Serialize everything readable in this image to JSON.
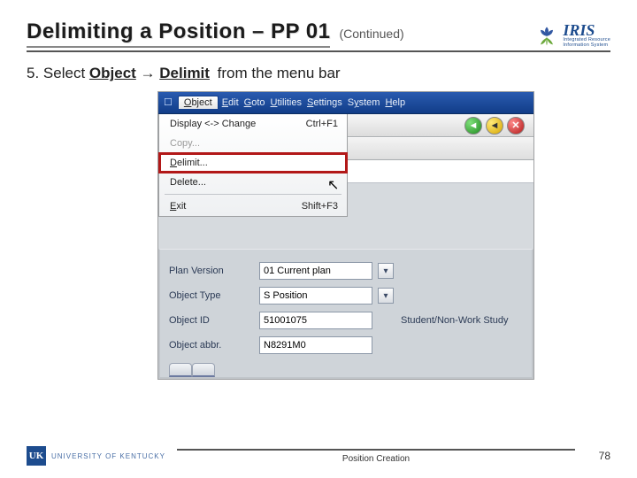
{
  "header": {
    "title": "Delimiting a Position – PP 01",
    "suffix": "(Continued)"
  },
  "iris": {
    "name": "IRIS",
    "tag1": "Integrated Resource",
    "tag2": "Information System"
  },
  "instruction": {
    "num": "5.",
    "lead": "Select ",
    "obj": "Object",
    "arrow": " → ",
    "del": "Delimit",
    "trail": " from the menu bar"
  },
  "sap": {
    "menu": {
      "object": "Object",
      "edit": "Edit",
      "goto": "Goto",
      "utilities": "Utilities",
      "settings": "Settings",
      "system": "System",
      "help": "Help"
    },
    "dropdown": {
      "display": {
        "label": "Display <-> Change",
        "shortcut": "Ctrl+F1"
      },
      "copy": "Copy...",
      "delimit": "Delimit...",
      "delete": "Delete...",
      "exit": {
        "label": "Exit",
        "shortcut": "Shift+F3"
      }
    },
    "toolbar": {
      "back": "◄",
      "fwd": "◄",
      "cancel": "✕"
    },
    "fields": {
      "plan": {
        "label": "Plan Version",
        "value": "01 Current plan"
      },
      "otype": {
        "label": "Object Type",
        "value": "S Position"
      },
      "oid": {
        "label": "Object ID",
        "value": "51001075",
        "desc": "Student/Non-Work Study"
      },
      "oabbr": {
        "label": "Object abbr.",
        "value": "N8291M0"
      }
    },
    "tabs": {
      "a": "",
      "b": ""
    }
  },
  "footer": {
    "uk": "UNIVERSITY OF KENTUCKY",
    "caption": "Position Creation",
    "page": "78"
  }
}
